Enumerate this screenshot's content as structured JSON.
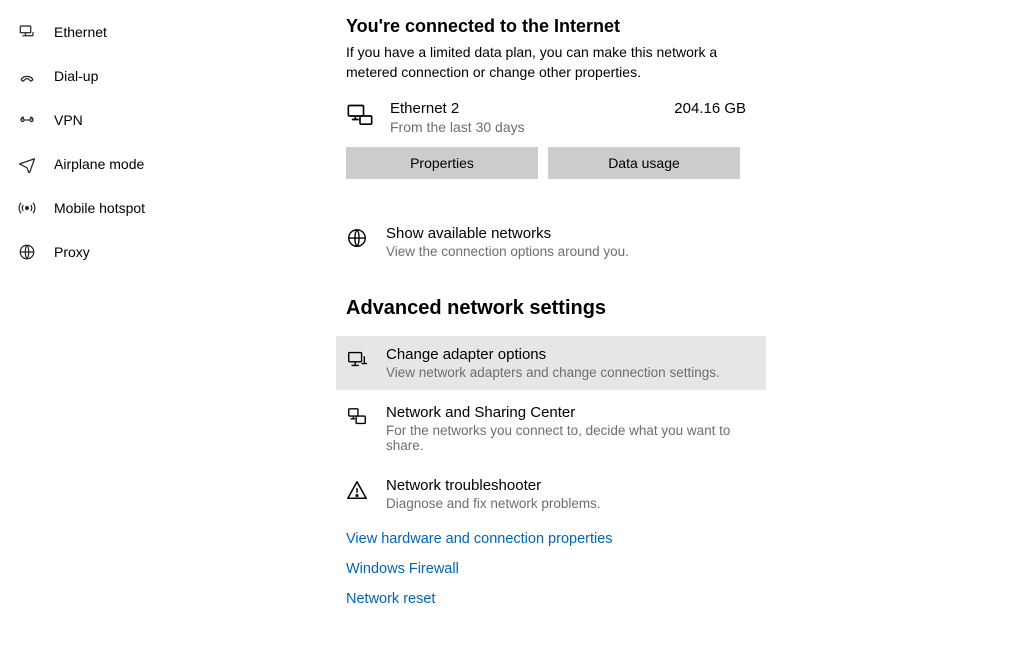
{
  "sidebar": {
    "items": [
      {
        "label": "Ethernet"
      },
      {
        "label": "Dial-up"
      },
      {
        "label": "VPN"
      },
      {
        "label": "Airplane mode"
      },
      {
        "label": "Mobile hotspot"
      },
      {
        "label": "Proxy"
      }
    ]
  },
  "status": {
    "heading": "You're connected to the Internet",
    "description": "If you have a limited data plan, you can make this network a metered connection or change other properties.",
    "connection": {
      "name": "Ethernet 2",
      "sub": "From the last 30 days",
      "usage": "204.16 GB"
    },
    "buttons": {
      "properties": "Properties",
      "data_usage": "Data usage"
    },
    "available": {
      "title": "Show available networks",
      "sub": "View the connection options around you."
    }
  },
  "advanced": {
    "heading": "Advanced network settings",
    "items": [
      {
        "title": "Change adapter options",
        "sub": "View network adapters and change connection settings."
      },
      {
        "title": "Network and Sharing Center",
        "sub": "For the networks you connect to, decide what you want to share."
      },
      {
        "title": "Network troubleshooter",
        "sub": "Diagnose and fix network problems."
      }
    ],
    "links": [
      "View hardware and connection properties",
      "Windows Firewall",
      "Network reset"
    ]
  }
}
